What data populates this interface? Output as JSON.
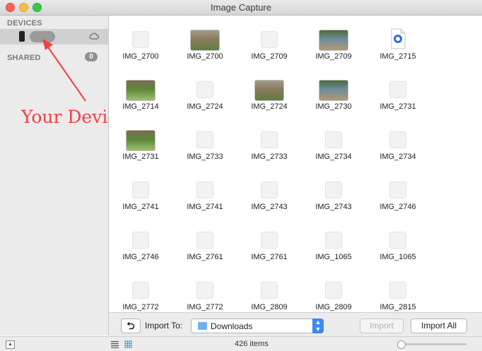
{
  "window": {
    "title": "Image Capture"
  },
  "sidebar": {
    "devices_label": "DEVICES",
    "shared_label": "SHARED",
    "shared_count": "0"
  },
  "annotation": {
    "text": "Your Device",
    "color": "#f14040"
  },
  "grid": {
    "rows": [
      [
        {
          "label": "IMG_2700",
          "thumb": "placeholder"
        },
        {
          "label": "IMG_2700",
          "thumb": "photo"
        },
        {
          "label": "IMG_2709",
          "thumb": "placeholder"
        },
        {
          "label": "IMG_2709",
          "thumb": "photo"
        },
        {
          "label": "IMG_2715",
          "thumb": "movie"
        }
      ],
      [
        {
          "label": "IMG_2714",
          "thumb": "photo"
        },
        {
          "label": "IMG_2724",
          "thumb": "placeholder"
        },
        {
          "label": "IMG_2724",
          "thumb": "photo"
        },
        {
          "label": "IMG_2730",
          "thumb": "photo"
        },
        {
          "label": "IMG_2731",
          "thumb": "placeholder"
        }
      ],
      [
        {
          "label": "IMG_2731",
          "thumb": "photo"
        },
        {
          "label": "IMG_2733",
          "thumb": "placeholder"
        },
        {
          "label": "IMG_2733",
          "thumb": "placeholder"
        },
        {
          "label": "IMG_2734",
          "thumb": "placeholder"
        },
        {
          "label": "IMG_2734",
          "thumb": "placeholder"
        }
      ],
      [
        {
          "label": "IMG_2741",
          "thumb": "placeholder"
        },
        {
          "label": "IMG_2741",
          "thumb": "placeholder"
        },
        {
          "label": "IMG_2743",
          "thumb": "placeholder"
        },
        {
          "label": "IMG_2743",
          "thumb": "placeholder"
        },
        {
          "label": "IMG_2746",
          "thumb": "placeholder"
        }
      ],
      [
        {
          "label": "IMG_2746",
          "thumb": "placeholder"
        },
        {
          "label": "IMG_2761",
          "thumb": "placeholder"
        },
        {
          "label": "IMG_2761",
          "thumb": "placeholder"
        },
        {
          "label": "IMG_1065",
          "thumb": "placeholder"
        },
        {
          "label": "IMG_1065",
          "thumb": "placeholder"
        }
      ],
      [
        {
          "label": "IMG_2772",
          "thumb": "placeholder"
        },
        {
          "label": "IMG_2772",
          "thumb": "placeholder"
        },
        {
          "label": "IMG_2809",
          "thumb": "placeholder"
        },
        {
          "label": "IMG_2809",
          "thumb": "placeholder"
        },
        {
          "label": "IMG_2815",
          "thumb": "placeholder"
        }
      ]
    ]
  },
  "toolbar": {
    "rotate_label": "⮌",
    "import_to_label": "Import To:",
    "destination": "Downloads",
    "import_label": "Import",
    "import_all_label": "Import All"
  },
  "status": {
    "item_count": "426 items",
    "zoom_fraction": 0.0
  },
  "colors": {
    "accent": "#3b8af0"
  }
}
